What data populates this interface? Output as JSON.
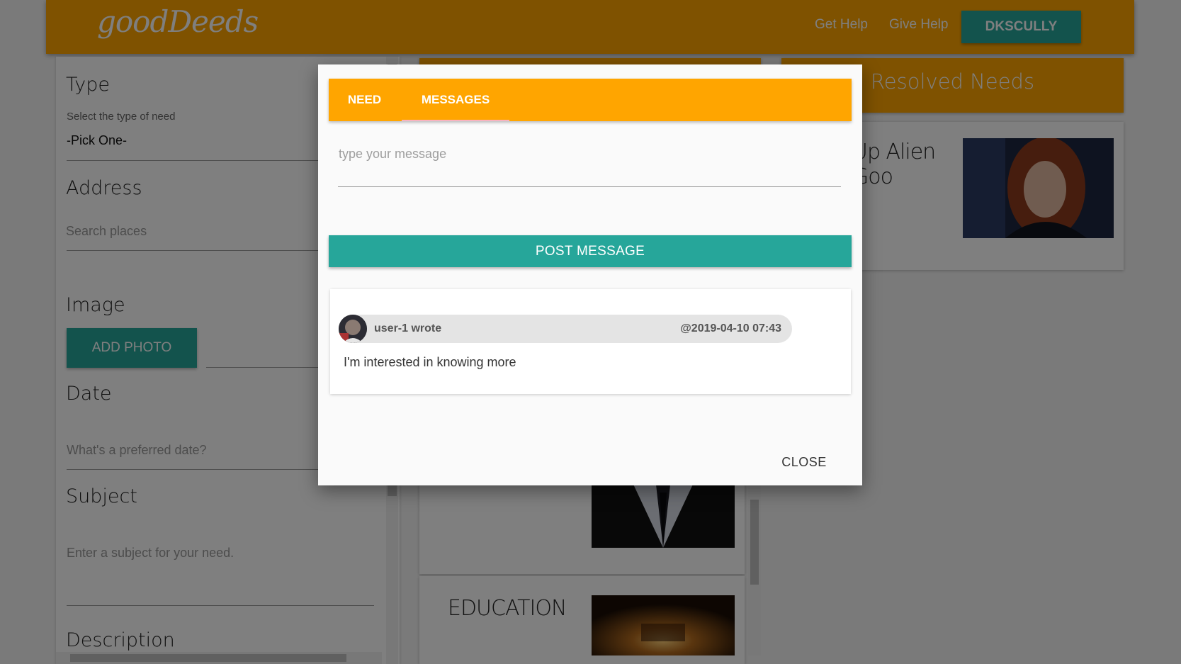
{
  "app": {
    "logo": "goodDeeds",
    "nav": {
      "get_help": "Get Help",
      "give_help": "Give Help",
      "user": "DKSCULLY"
    }
  },
  "form": {
    "type_heading": "Type",
    "type_hint": "Select the type of need",
    "type_value": "-Pick One-",
    "address_heading": "Address",
    "address_placeholder": "Search places",
    "image_heading": "Image",
    "add_photo": "ADD PHOTO",
    "date_heading": "Date",
    "date_placeholder": "What's a preferred date?",
    "subject_heading": "Subject",
    "subject_placeholder": "Enter a subject for your need.",
    "description_heading": "Description"
  },
  "needs_list": {
    "cards": [
      {
        "title": "EDUCATION"
      }
    ]
  },
  "resolved": {
    "heading": "Resolved Needs",
    "card_title_line1": "Up Alien",
    "card_title_line2": "Goo"
  },
  "modal": {
    "tabs": [
      {
        "label": "NEED"
      },
      {
        "label": "MESSAGES"
      }
    ],
    "active_tab": "MESSAGES",
    "message_placeholder": "type your message",
    "post_button": "POST MESSAGE",
    "messages": [
      {
        "author": "user-1 wrote",
        "date": "@2019-04-10 07:43",
        "text": "I'm interested in knowing more"
      }
    ],
    "close_button": "CLOSE"
  },
  "colors": {
    "accent": "#ffa500",
    "primary": "#26a69a",
    "tab_indicator": "#f8b3c0"
  }
}
